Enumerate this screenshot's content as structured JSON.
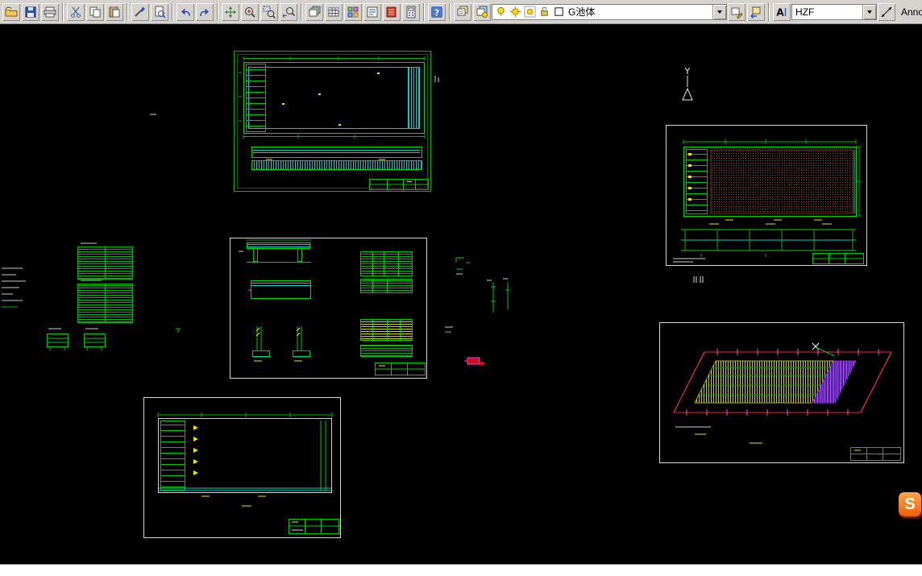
{
  "app": {
    "toolbar_background": "#d6d3ce",
    "canvas_background": "#000000"
  },
  "standard_toolbar": {
    "buttons": [
      {
        "name": "open",
        "title": "Open"
      },
      {
        "name": "save",
        "title": "Save"
      },
      {
        "name": "plot",
        "title": "Plot"
      },
      {
        "name": "cut",
        "title": "Cut to Clipboard"
      },
      {
        "name": "copy",
        "title": "Copy to Clipboard"
      },
      {
        "name": "paste",
        "title": "Paste from Clipboard"
      },
      {
        "name": "match-properties",
        "title": "Match Properties"
      },
      {
        "name": "plot-preview",
        "title": "Plot Preview"
      },
      {
        "name": "undo",
        "title": "Undo"
      },
      {
        "name": "redo",
        "title": "Redo"
      },
      {
        "name": "pan",
        "title": "Pan Realtime"
      },
      {
        "name": "zoom-realtime",
        "title": "Zoom Realtime"
      },
      {
        "name": "zoom-window",
        "title": "Zoom Window"
      },
      {
        "name": "zoom-previous",
        "title": "Zoom Previous"
      },
      {
        "name": "layer-properties",
        "title": "Layer Properties Manager"
      },
      {
        "name": "table",
        "title": "Table"
      },
      {
        "name": "designcenter",
        "title": "DesignCenter"
      },
      {
        "name": "sheet-set",
        "title": "Sheet Set Manager"
      },
      {
        "name": "dbconnect",
        "title": "dbConnect"
      },
      {
        "name": "quickcalc",
        "title": "QuickCalc"
      },
      {
        "name": "help",
        "title": "Help"
      }
    ]
  },
  "layer_toolbar": {
    "layer_manager_title": "Layer Properties Manager",
    "layer_states_title": "Layer States Manager",
    "current_layer": "G池体",
    "make_current_title": "Make Object's Layer Current",
    "layer_previous_title": "Layer Previous"
  },
  "style_toolbar": {
    "text_style_title": "Text Style",
    "text_style": "HZF",
    "dim_style_title": "Dimension Style",
    "annotation_label": "Annotati"
  },
  "command_bar": {
    "text": ""
  },
  "watermark": {
    "letter": "S"
  },
  "cad_colors": {
    "entity_green": "#00c800",
    "entity_cyan": "#00cdcd",
    "entity_yellow": "#e8e800",
    "entity_red": "#e03030",
    "entity_magenta": "#ff40ff",
    "hatch_brown": "#b04818",
    "sheet_border": "#d8d8d8"
  }
}
